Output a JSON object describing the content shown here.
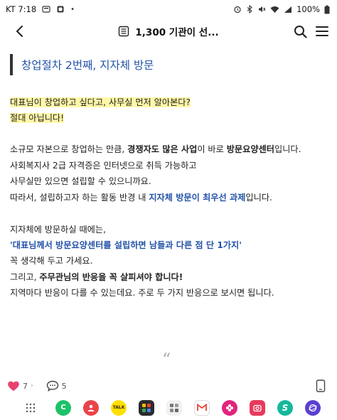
{
  "status": {
    "carrier_time": "KT 7:18",
    "battery": "100%"
  },
  "header": {
    "title": "1,300 기관이 선..."
  },
  "article": {
    "heading": "창업절차 2번째,  지자체 방문",
    "q1": "대표님이 창업하고 싶다고, 사무실 먼저 알아본다?",
    "q2": "절대 아닙니다!",
    "p1a": "소규모 자본으로 창업하는 만큼, ",
    "p1b": "경쟁자도 많은 사업",
    "p1c": "이 바로 ",
    "p1d": "방문요양센터",
    "p1e": "입니다.",
    "p2": "사회복지사 2급 자격증은 인터넷으로 취득 가능하고",
    "p3": "사무실만 있으면 설립할 수 있으니까요.",
    "p4a": "따라서, 설립하고자 하는 활동 반경 내 ",
    "p4b": "지자체 방문이 최우선 과제",
    "p4c": "입니다.",
    "p5": "지자체에 방문하실 때에는,",
    "p6": "'대표님께서 방문요양센터를 설립하면 남들과 다른 점 단 1가지'",
    "p7": "꼭 생각해 두고 가세요.",
    "p8a": "그리고, ",
    "p8b": "주무관님의 반응을 꼭 살피셔야 합니다!",
    "p9": "지역마다 반응이 다를 수 있는데요. 주로 두 가지 반응으로 보시면 됩니다.",
    "quote_mark": "“"
  },
  "reactions": {
    "likes": "7",
    "comments": "5"
  },
  "colors": {
    "accent_blue": "#2453a8",
    "highlight": "#fff7a8"
  }
}
